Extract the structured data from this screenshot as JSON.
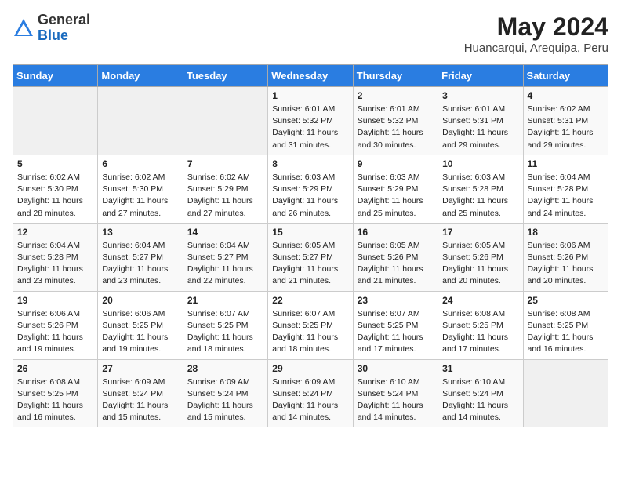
{
  "logo": {
    "general": "General",
    "blue": "Blue"
  },
  "title": "May 2024",
  "location": "Huancarqui, Arequipa, Peru",
  "days_of_week": [
    "Sunday",
    "Monday",
    "Tuesday",
    "Wednesday",
    "Thursday",
    "Friday",
    "Saturday"
  ],
  "weeks": [
    [
      {
        "day": "",
        "info": ""
      },
      {
        "day": "",
        "info": ""
      },
      {
        "day": "",
        "info": ""
      },
      {
        "day": "1",
        "info": "Sunrise: 6:01 AM\nSunset: 5:32 PM\nDaylight: 11 hours and 31 minutes."
      },
      {
        "day": "2",
        "info": "Sunrise: 6:01 AM\nSunset: 5:32 PM\nDaylight: 11 hours and 30 minutes."
      },
      {
        "day": "3",
        "info": "Sunrise: 6:01 AM\nSunset: 5:31 PM\nDaylight: 11 hours and 29 minutes."
      },
      {
        "day": "4",
        "info": "Sunrise: 6:02 AM\nSunset: 5:31 PM\nDaylight: 11 hours and 29 minutes."
      }
    ],
    [
      {
        "day": "5",
        "info": "Sunrise: 6:02 AM\nSunset: 5:30 PM\nDaylight: 11 hours and 28 minutes."
      },
      {
        "day": "6",
        "info": "Sunrise: 6:02 AM\nSunset: 5:30 PM\nDaylight: 11 hours and 27 minutes."
      },
      {
        "day": "7",
        "info": "Sunrise: 6:02 AM\nSunset: 5:29 PM\nDaylight: 11 hours and 27 minutes."
      },
      {
        "day": "8",
        "info": "Sunrise: 6:03 AM\nSunset: 5:29 PM\nDaylight: 11 hours and 26 minutes."
      },
      {
        "day": "9",
        "info": "Sunrise: 6:03 AM\nSunset: 5:29 PM\nDaylight: 11 hours and 25 minutes."
      },
      {
        "day": "10",
        "info": "Sunrise: 6:03 AM\nSunset: 5:28 PM\nDaylight: 11 hours and 25 minutes."
      },
      {
        "day": "11",
        "info": "Sunrise: 6:04 AM\nSunset: 5:28 PM\nDaylight: 11 hours and 24 minutes."
      }
    ],
    [
      {
        "day": "12",
        "info": "Sunrise: 6:04 AM\nSunset: 5:28 PM\nDaylight: 11 hours and 23 minutes."
      },
      {
        "day": "13",
        "info": "Sunrise: 6:04 AM\nSunset: 5:27 PM\nDaylight: 11 hours and 23 minutes."
      },
      {
        "day": "14",
        "info": "Sunrise: 6:04 AM\nSunset: 5:27 PM\nDaylight: 11 hours and 22 minutes."
      },
      {
        "day": "15",
        "info": "Sunrise: 6:05 AM\nSunset: 5:27 PM\nDaylight: 11 hours and 21 minutes."
      },
      {
        "day": "16",
        "info": "Sunrise: 6:05 AM\nSunset: 5:26 PM\nDaylight: 11 hours and 21 minutes."
      },
      {
        "day": "17",
        "info": "Sunrise: 6:05 AM\nSunset: 5:26 PM\nDaylight: 11 hours and 20 minutes."
      },
      {
        "day": "18",
        "info": "Sunrise: 6:06 AM\nSunset: 5:26 PM\nDaylight: 11 hours and 20 minutes."
      }
    ],
    [
      {
        "day": "19",
        "info": "Sunrise: 6:06 AM\nSunset: 5:26 PM\nDaylight: 11 hours and 19 minutes."
      },
      {
        "day": "20",
        "info": "Sunrise: 6:06 AM\nSunset: 5:25 PM\nDaylight: 11 hours and 19 minutes."
      },
      {
        "day": "21",
        "info": "Sunrise: 6:07 AM\nSunset: 5:25 PM\nDaylight: 11 hours and 18 minutes."
      },
      {
        "day": "22",
        "info": "Sunrise: 6:07 AM\nSunset: 5:25 PM\nDaylight: 11 hours and 18 minutes."
      },
      {
        "day": "23",
        "info": "Sunrise: 6:07 AM\nSunset: 5:25 PM\nDaylight: 11 hours and 17 minutes."
      },
      {
        "day": "24",
        "info": "Sunrise: 6:08 AM\nSunset: 5:25 PM\nDaylight: 11 hours and 17 minutes."
      },
      {
        "day": "25",
        "info": "Sunrise: 6:08 AM\nSunset: 5:25 PM\nDaylight: 11 hours and 16 minutes."
      }
    ],
    [
      {
        "day": "26",
        "info": "Sunrise: 6:08 AM\nSunset: 5:25 PM\nDaylight: 11 hours and 16 minutes."
      },
      {
        "day": "27",
        "info": "Sunrise: 6:09 AM\nSunset: 5:24 PM\nDaylight: 11 hours and 15 minutes."
      },
      {
        "day": "28",
        "info": "Sunrise: 6:09 AM\nSunset: 5:24 PM\nDaylight: 11 hours and 15 minutes."
      },
      {
        "day": "29",
        "info": "Sunrise: 6:09 AM\nSunset: 5:24 PM\nDaylight: 11 hours and 14 minutes."
      },
      {
        "day": "30",
        "info": "Sunrise: 6:10 AM\nSunset: 5:24 PM\nDaylight: 11 hours and 14 minutes."
      },
      {
        "day": "31",
        "info": "Sunrise: 6:10 AM\nSunset: 5:24 PM\nDaylight: 11 hours and 14 minutes."
      },
      {
        "day": "",
        "info": ""
      }
    ]
  ]
}
